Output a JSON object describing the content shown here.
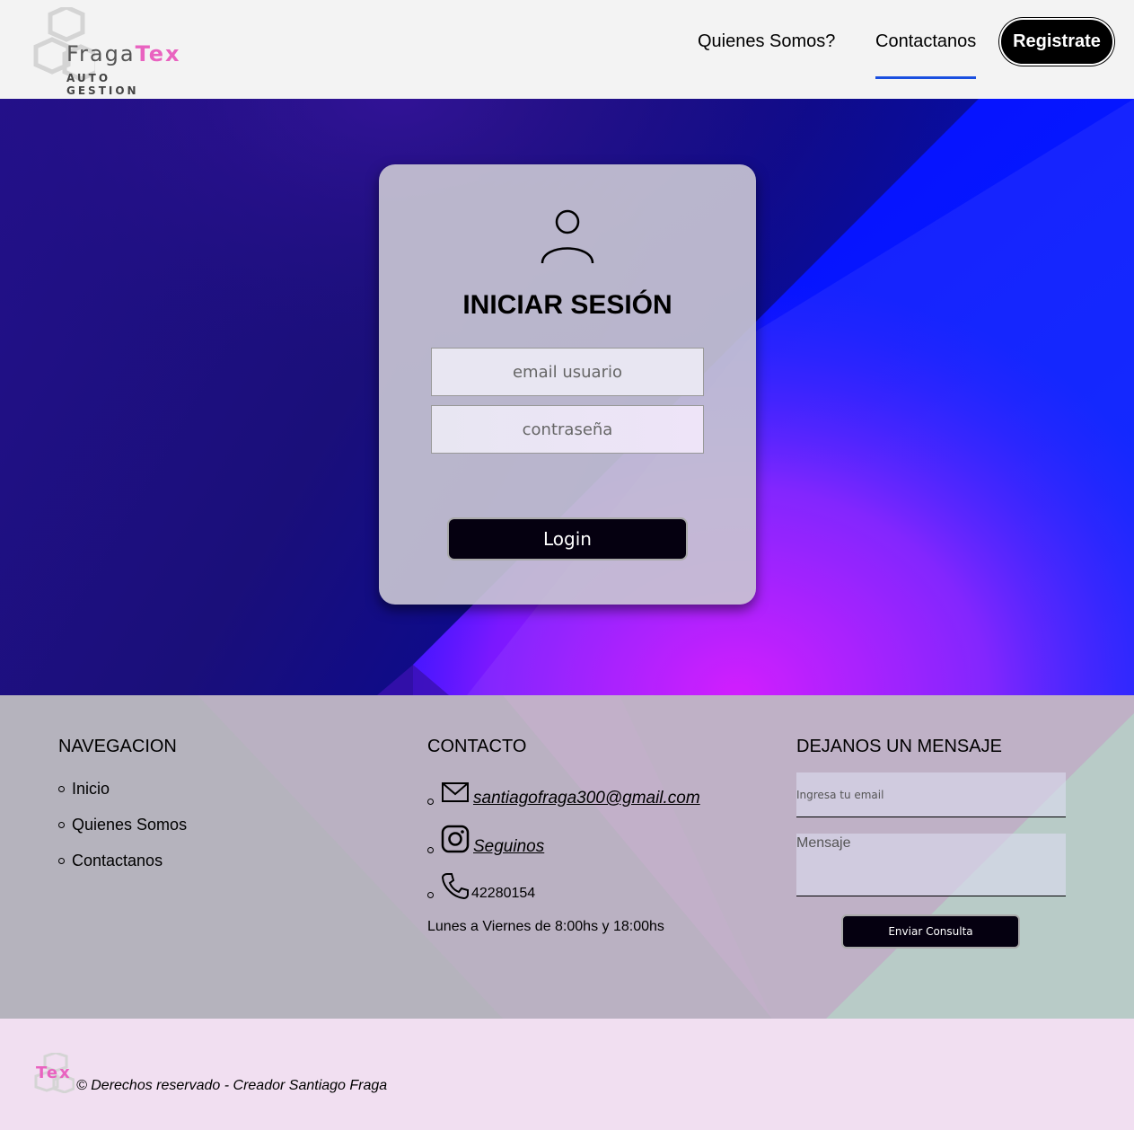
{
  "header": {
    "logo_main": "Fraga",
    "logo_accent": "Tex",
    "logo_sub": "AUTO GESTION",
    "nav": [
      {
        "label": "Quienes Somos?"
      },
      {
        "label": "Contactanos"
      }
    ],
    "register_label": "Registrate"
  },
  "login": {
    "title": "INICIAR SESIÓN",
    "email_placeholder": "email usuario",
    "password_placeholder": "contraseña",
    "button_label": "Login"
  },
  "footer": {
    "nav_heading": "NAVEGACION",
    "nav_items": [
      "Inicio",
      "Quienes Somos",
      "Contactanos"
    ],
    "contact_heading": "CONTACTO",
    "email": "santiagofraga300@gmail.com",
    "instagram_label": "Seguinos",
    "phone": "42280154",
    "hours": "Lunes a Viernes de 8:00hs y 18:00hs",
    "message_heading": "DEJANOS UN MENSAJE",
    "email_input_placeholder": "Ingresa tu email",
    "message_placeholder": "Mensaje",
    "send_label": "Enviar Consulta"
  },
  "bottom": {
    "mini_logo": "Tex",
    "copyright": "© Derechos reservado - Creador Santiago Fraga"
  },
  "colors": {
    "accent_pink": "#e963c0",
    "nav_underline": "#1a4fe0",
    "hero_blue": "#0016d6",
    "hero_magenta": "#d010ff"
  }
}
